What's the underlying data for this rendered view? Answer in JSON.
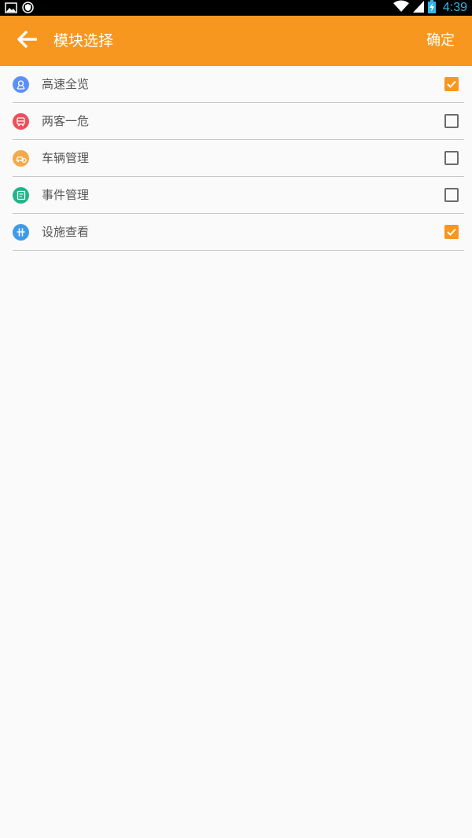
{
  "status_bar": {
    "time": "4:39",
    "left_icons": [
      "image-icon",
      "shield-icon"
    ],
    "right_icons": [
      "wifi-icon",
      "signal-icon",
      "battery-charging-icon"
    ]
  },
  "header": {
    "title": "模块选择",
    "confirm_label": "确定",
    "back_icon": "arrow-back-icon",
    "background_color": "#f7971f"
  },
  "modules": [
    {
      "label": "高速全览",
      "checked": true,
      "icon": "map-pin-icon",
      "color": "#5b8ff9"
    },
    {
      "label": "两客一危",
      "checked": false,
      "icon": "bus-icon",
      "color": "#ef4e5b"
    },
    {
      "label": "车辆管理",
      "checked": false,
      "icon": "car-settings-icon",
      "color": "#f4a94a"
    },
    {
      "label": "事件管理",
      "checked": false,
      "icon": "document-icon",
      "color": "#22b48a"
    },
    {
      "label": "设施查看",
      "checked": true,
      "icon": "facility-icon",
      "color": "#3d9be9"
    }
  ],
  "checkbox_color": "#f7971f"
}
